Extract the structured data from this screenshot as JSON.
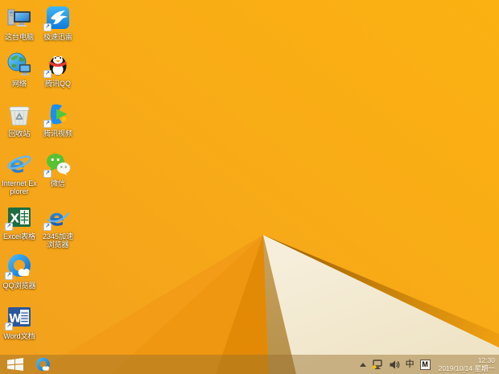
{
  "wallpaper": {
    "base_bottom_left": "#F2A01E",
    "base_top_right": "#FBB112",
    "fold_wedge_light": "#F29C18",
    "fold_wedge_mid": "#EF9711",
    "fold_wedge_dark": "#E28A06",
    "shadow_tan": "#C29B54",
    "cream_facet": "#F3EAD2",
    "fold_edge_dark": "#9C6105",
    "fold_edge_light": "#F0A011"
  },
  "desktop": {
    "icons": [
      {
        "label": "这台电脑"
      },
      {
        "label": "极速迅雷"
      },
      {
        "label": "网络"
      },
      {
        "label": "腾讯QQ"
      },
      {
        "label": "回收站"
      },
      {
        "label": "腾讯视频"
      },
      {
        "label": "Internet Explorer"
      },
      {
        "label": "微信"
      },
      {
        "label": "Excel表格"
      },
      {
        "label": "2345加速浏览器"
      },
      {
        "label": "QQ浏览器"
      },
      {
        "label": "Word文档"
      }
    ]
  },
  "taskbar": {
    "color": "rgba(150,110,45,0.45)",
    "tray": {
      "ime_mode": "中",
      "ime_badge": "M",
      "time": "12:30",
      "date": "2019/10/14 星期一"
    }
  }
}
